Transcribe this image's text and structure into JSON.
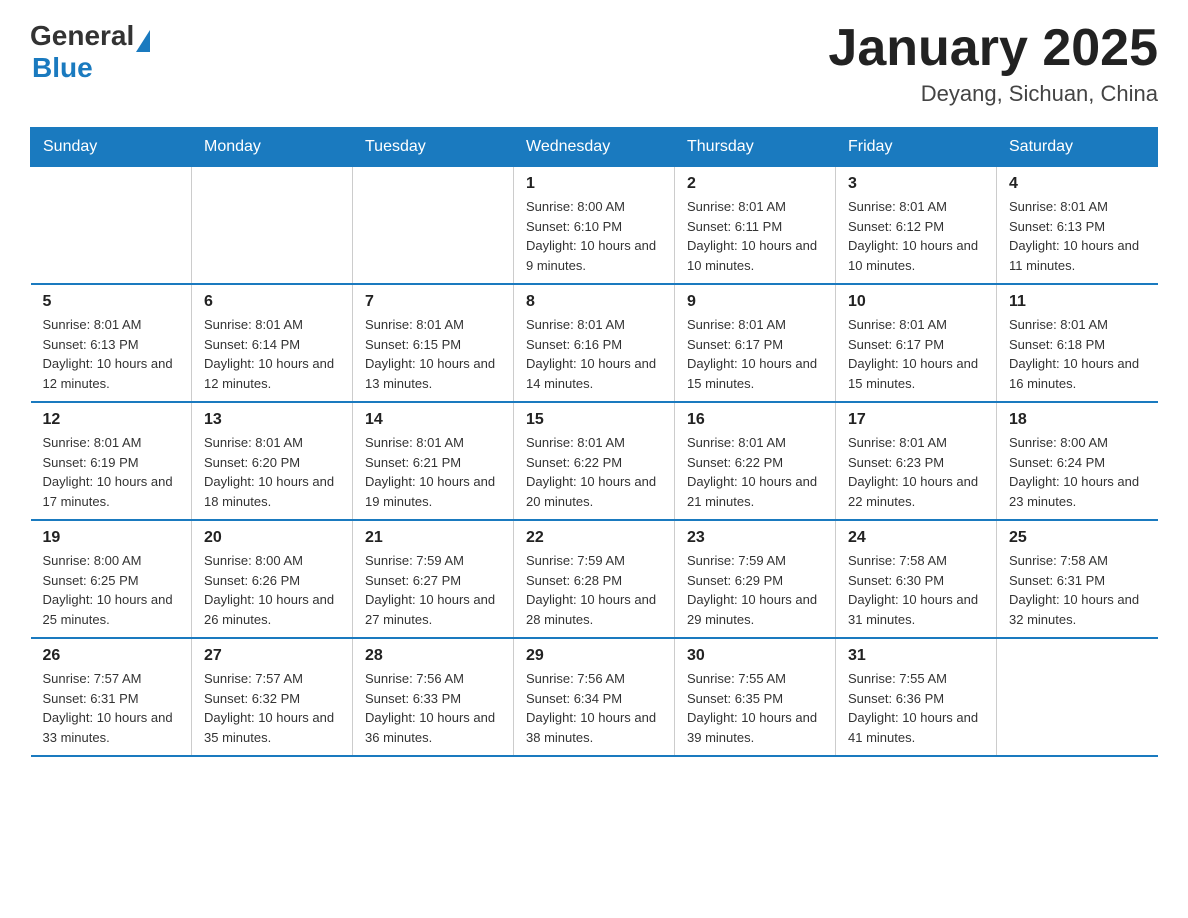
{
  "header": {
    "logo": {
      "general": "General",
      "blue": "Blue"
    },
    "title": "January 2025",
    "subtitle": "Deyang, Sichuan, China"
  },
  "days_of_week": [
    "Sunday",
    "Monday",
    "Tuesday",
    "Wednesday",
    "Thursday",
    "Friday",
    "Saturday"
  ],
  "weeks": [
    [
      {
        "day": "",
        "info": ""
      },
      {
        "day": "",
        "info": ""
      },
      {
        "day": "",
        "info": ""
      },
      {
        "day": "1",
        "sunrise": "Sunrise: 8:00 AM",
        "sunset": "Sunset: 6:10 PM",
        "daylight": "Daylight: 10 hours and 9 minutes."
      },
      {
        "day": "2",
        "sunrise": "Sunrise: 8:01 AM",
        "sunset": "Sunset: 6:11 PM",
        "daylight": "Daylight: 10 hours and 10 minutes."
      },
      {
        "day": "3",
        "sunrise": "Sunrise: 8:01 AM",
        "sunset": "Sunset: 6:12 PM",
        "daylight": "Daylight: 10 hours and 10 minutes."
      },
      {
        "day": "4",
        "sunrise": "Sunrise: 8:01 AM",
        "sunset": "Sunset: 6:13 PM",
        "daylight": "Daylight: 10 hours and 11 minutes."
      }
    ],
    [
      {
        "day": "5",
        "sunrise": "Sunrise: 8:01 AM",
        "sunset": "Sunset: 6:13 PM",
        "daylight": "Daylight: 10 hours and 12 minutes."
      },
      {
        "day": "6",
        "sunrise": "Sunrise: 8:01 AM",
        "sunset": "Sunset: 6:14 PM",
        "daylight": "Daylight: 10 hours and 12 minutes."
      },
      {
        "day": "7",
        "sunrise": "Sunrise: 8:01 AM",
        "sunset": "Sunset: 6:15 PM",
        "daylight": "Daylight: 10 hours and 13 minutes."
      },
      {
        "day": "8",
        "sunrise": "Sunrise: 8:01 AM",
        "sunset": "Sunset: 6:16 PM",
        "daylight": "Daylight: 10 hours and 14 minutes."
      },
      {
        "day": "9",
        "sunrise": "Sunrise: 8:01 AM",
        "sunset": "Sunset: 6:17 PM",
        "daylight": "Daylight: 10 hours and 15 minutes."
      },
      {
        "day": "10",
        "sunrise": "Sunrise: 8:01 AM",
        "sunset": "Sunset: 6:17 PM",
        "daylight": "Daylight: 10 hours and 15 minutes."
      },
      {
        "day": "11",
        "sunrise": "Sunrise: 8:01 AM",
        "sunset": "Sunset: 6:18 PM",
        "daylight": "Daylight: 10 hours and 16 minutes."
      }
    ],
    [
      {
        "day": "12",
        "sunrise": "Sunrise: 8:01 AM",
        "sunset": "Sunset: 6:19 PM",
        "daylight": "Daylight: 10 hours and 17 minutes."
      },
      {
        "day": "13",
        "sunrise": "Sunrise: 8:01 AM",
        "sunset": "Sunset: 6:20 PM",
        "daylight": "Daylight: 10 hours and 18 minutes."
      },
      {
        "day": "14",
        "sunrise": "Sunrise: 8:01 AM",
        "sunset": "Sunset: 6:21 PM",
        "daylight": "Daylight: 10 hours and 19 minutes."
      },
      {
        "day": "15",
        "sunrise": "Sunrise: 8:01 AM",
        "sunset": "Sunset: 6:22 PM",
        "daylight": "Daylight: 10 hours and 20 minutes."
      },
      {
        "day": "16",
        "sunrise": "Sunrise: 8:01 AM",
        "sunset": "Sunset: 6:22 PM",
        "daylight": "Daylight: 10 hours and 21 minutes."
      },
      {
        "day": "17",
        "sunrise": "Sunrise: 8:01 AM",
        "sunset": "Sunset: 6:23 PM",
        "daylight": "Daylight: 10 hours and 22 minutes."
      },
      {
        "day": "18",
        "sunrise": "Sunrise: 8:00 AM",
        "sunset": "Sunset: 6:24 PM",
        "daylight": "Daylight: 10 hours and 23 minutes."
      }
    ],
    [
      {
        "day": "19",
        "sunrise": "Sunrise: 8:00 AM",
        "sunset": "Sunset: 6:25 PM",
        "daylight": "Daylight: 10 hours and 25 minutes."
      },
      {
        "day": "20",
        "sunrise": "Sunrise: 8:00 AM",
        "sunset": "Sunset: 6:26 PM",
        "daylight": "Daylight: 10 hours and 26 minutes."
      },
      {
        "day": "21",
        "sunrise": "Sunrise: 7:59 AM",
        "sunset": "Sunset: 6:27 PM",
        "daylight": "Daylight: 10 hours and 27 minutes."
      },
      {
        "day": "22",
        "sunrise": "Sunrise: 7:59 AM",
        "sunset": "Sunset: 6:28 PM",
        "daylight": "Daylight: 10 hours and 28 minutes."
      },
      {
        "day": "23",
        "sunrise": "Sunrise: 7:59 AM",
        "sunset": "Sunset: 6:29 PM",
        "daylight": "Daylight: 10 hours and 29 minutes."
      },
      {
        "day": "24",
        "sunrise": "Sunrise: 7:58 AM",
        "sunset": "Sunset: 6:30 PM",
        "daylight": "Daylight: 10 hours and 31 minutes."
      },
      {
        "day": "25",
        "sunrise": "Sunrise: 7:58 AM",
        "sunset": "Sunset: 6:31 PM",
        "daylight": "Daylight: 10 hours and 32 minutes."
      }
    ],
    [
      {
        "day": "26",
        "sunrise": "Sunrise: 7:57 AM",
        "sunset": "Sunset: 6:31 PM",
        "daylight": "Daylight: 10 hours and 33 minutes."
      },
      {
        "day": "27",
        "sunrise": "Sunrise: 7:57 AM",
        "sunset": "Sunset: 6:32 PM",
        "daylight": "Daylight: 10 hours and 35 minutes."
      },
      {
        "day": "28",
        "sunrise": "Sunrise: 7:56 AM",
        "sunset": "Sunset: 6:33 PM",
        "daylight": "Daylight: 10 hours and 36 minutes."
      },
      {
        "day": "29",
        "sunrise": "Sunrise: 7:56 AM",
        "sunset": "Sunset: 6:34 PM",
        "daylight": "Daylight: 10 hours and 38 minutes."
      },
      {
        "day": "30",
        "sunrise": "Sunrise: 7:55 AM",
        "sunset": "Sunset: 6:35 PM",
        "daylight": "Daylight: 10 hours and 39 minutes."
      },
      {
        "day": "31",
        "sunrise": "Sunrise: 7:55 AM",
        "sunset": "Sunset: 6:36 PM",
        "daylight": "Daylight: 10 hours and 41 minutes."
      },
      {
        "day": "",
        "info": ""
      }
    ]
  ]
}
